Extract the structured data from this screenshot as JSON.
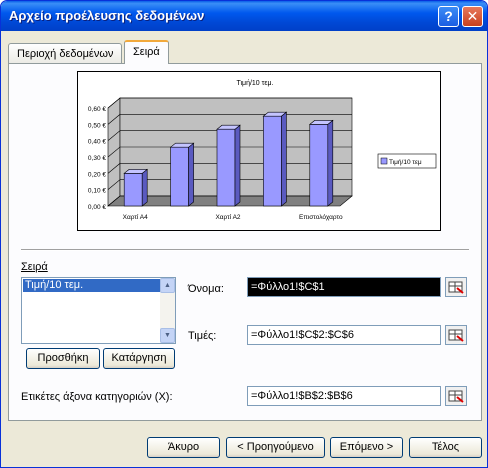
{
  "window": {
    "title": "Αρχείο προέλευσης δεδομένων",
    "help_label": "?",
    "close_label": "✕"
  },
  "tabs": [
    {
      "label": "Περιοχή δεδομένων",
      "selected": false
    },
    {
      "label": "Σειρά",
      "selected": true
    }
  ],
  "chart_data": {
    "type": "bar",
    "title": "Τιμή/10 τεμ.",
    "categories": [
      "Χαρτί Α4",
      "",
      "Χαρτί Α2",
      "",
      "Επιστολόχαρτο"
    ],
    "series": [
      {
        "name": "Τιμή/10 τεμ",
        "values": [
          0.2,
          0.36,
          0.47,
          0.55,
          0.5
        ]
      }
    ],
    "y_ticks": [
      "0,00 €",
      "0,10 €",
      "0,20 €",
      "0,30 €",
      "0,40 €",
      "0,50 €",
      "0,60 €"
    ],
    "ylim": [
      0,
      0.6
    ],
    "grid": true,
    "legend": "right",
    "colors": {
      "bar": "#9999ff",
      "bar_side": "#5a5ac0",
      "bar_top": "#c4c4ff",
      "wall": "#c0c0c0",
      "floor": "#808080"
    }
  },
  "series_section": {
    "label": "Σειρά",
    "items": [
      "Τιμή/10 τεμ."
    ],
    "add_label": "Προσθήκη",
    "remove_label": "Κατάργηση"
  },
  "fields": {
    "name_label": "Όνομα:",
    "name_value": "=Φύλλο1!$C$1",
    "values_label": "Τιμές:",
    "values_value": "=Φύλλο1!$C$2:$C$6",
    "category_label": "Ετικέτες άξονα κατηγοριών (X):",
    "category_value": "=Φύλλο1!$B$2:$B$6"
  },
  "footer": {
    "cancel_label": "Άκυρο",
    "back_label": "< Προηγούμενο",
    "next_label": "Επόμενο >",
    "finish_label": "Τέλος"
  }
}
